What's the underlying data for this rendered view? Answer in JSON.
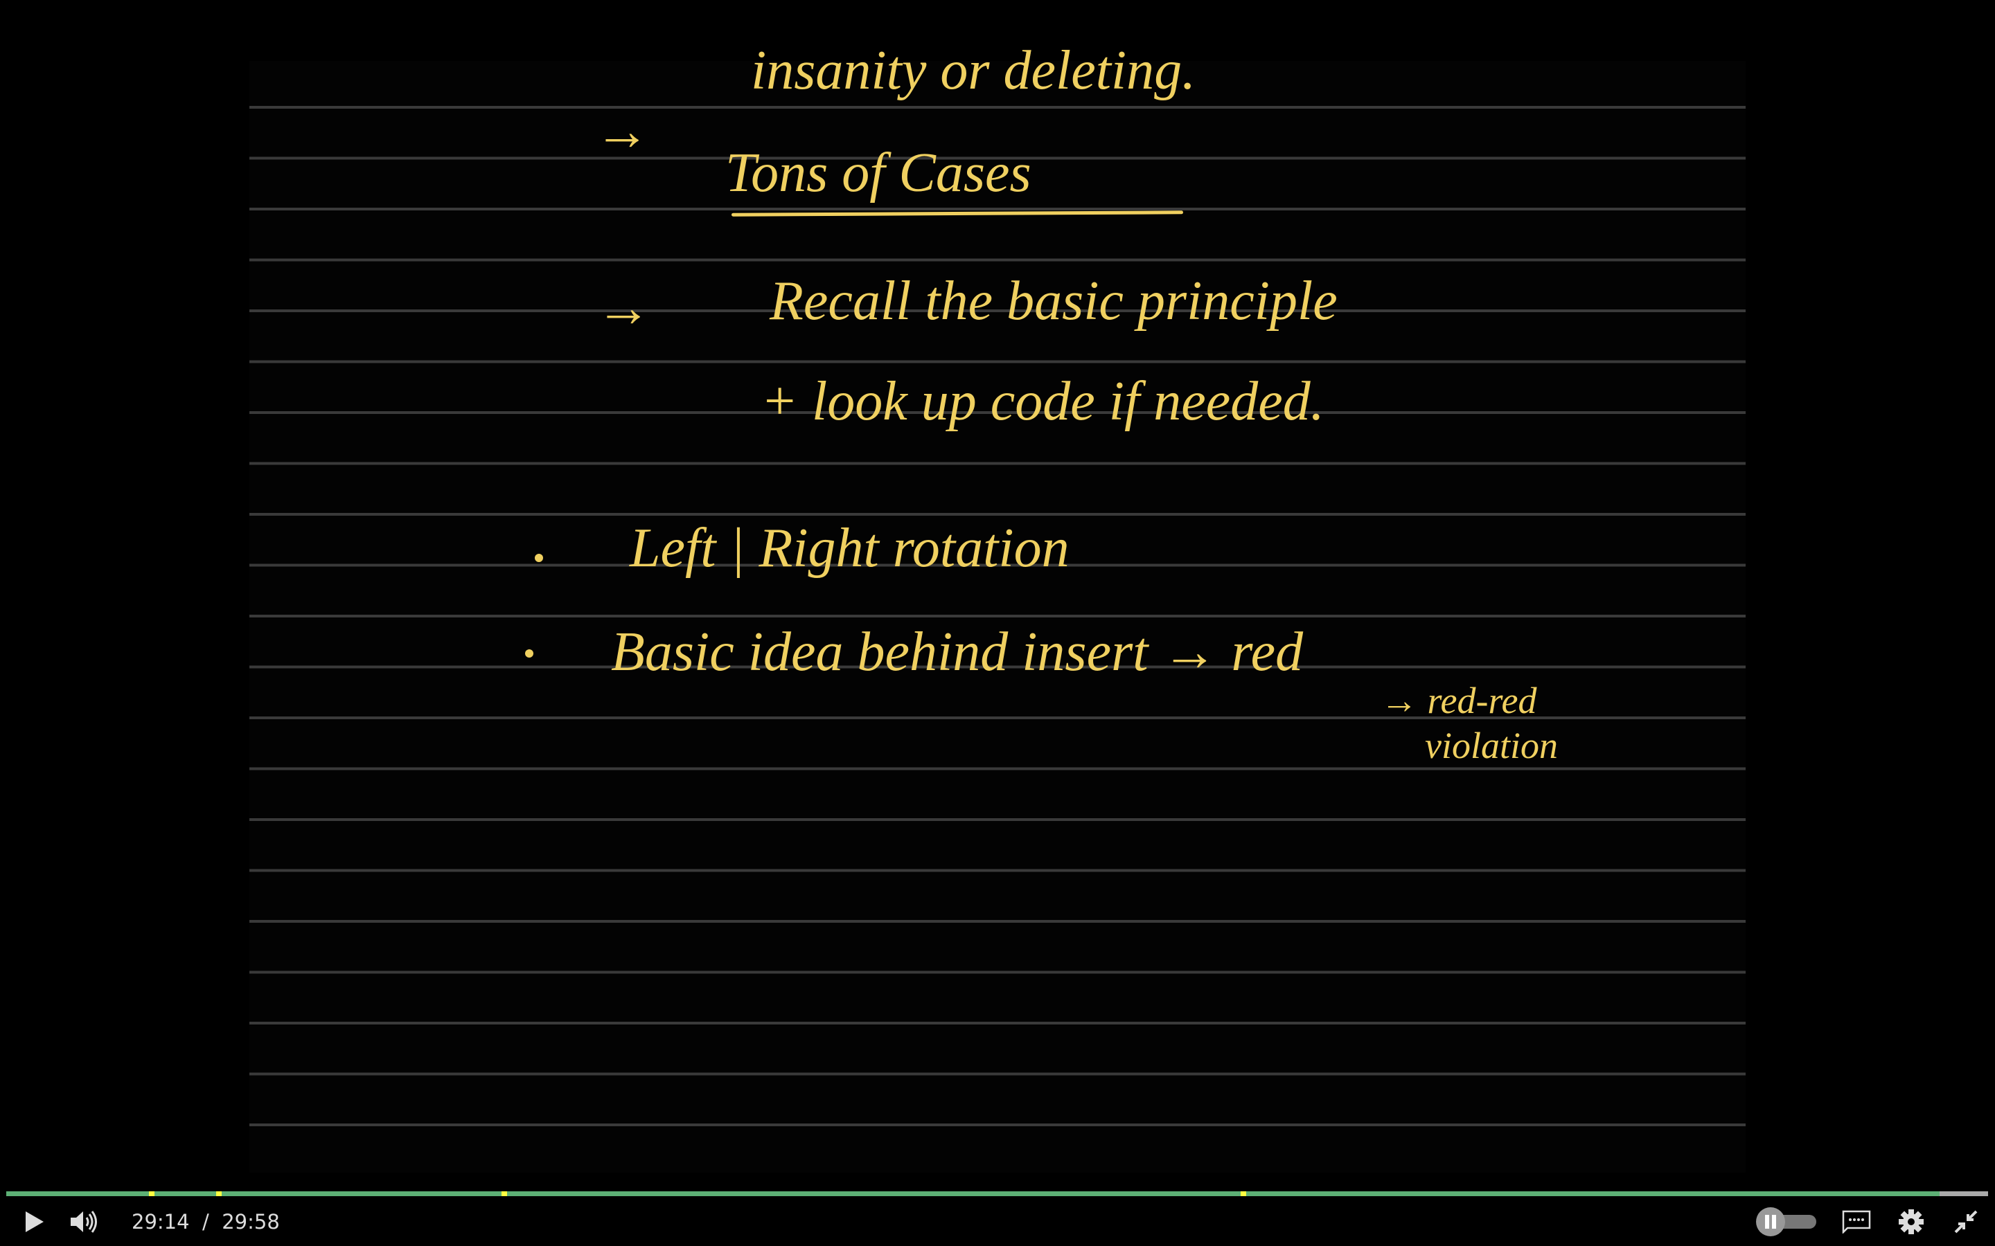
{
  "notes": {
    "line_top": "insanity or deleting.",
    "arrow": "→",
    "heading": "Tons of Cases",
    "recall": "Recall the basic principle",
    "lookup": "+ look up code if needed.",
    "bullet1": "Left | Right rotation",
    "bullet2": "Basic idea behind insert → red",
    "sub1": "→ red-red",
    "sub2": "violation"
  },
  "player": {
    "current_time": "29:14",
    "separator": "/",
    "duration": "29:58",
    "progress_fraction": 0.9755,
    "chapter_markers_fraction": [
      0.072,
      0.106,
      0.25,
      0.623
    ],
    "autoplay_toggle_state": "paused",
    "colors": {
      "played": "#5db075",
      "marker": "#ffff40",
      "ink": "#f0d060"
    }
  }
}
